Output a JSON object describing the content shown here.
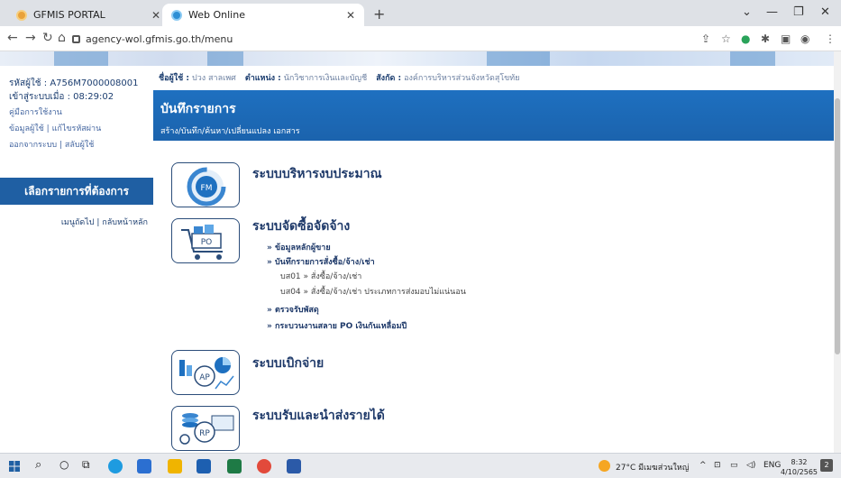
{
  "browser": {
    "tabs": [
      {
        "title": "GFMIS PORTAL",
        "active": false
      },
      {
        "title": "Web Online",
        "active": true
      }
    ],
    "url": "agency-wol.gfmis.go.th/menu"
  },
  "sidebar": {
    "user_id": "รหัสผู้ใช้ : A756M7000008001",
    "login_time": "เข้าสู่ระบบเมื่อ : 08:29:02",
    "manual_link": "คู่มือการใช้งาน",
    "user_info_link": "ข้อมูลผู้ใช้",
    "change_password_link": "แก้ไขรหัสผ่าน",
    "logout_link": "ออกจากระบบ",
    "switch_user_link": "สลับผู้ใช้",
    "menu_title": "เลือกรายการที่ต้องการ",
    "next_menu_link": "เมนูถัดไป",
    "home_link": "กลับหน้าหลัก"
  },
  "userbar": {
    "user_label": "ชื่อผู้ใช้ :",
    "user_value": "ปวง สาลเพศ",
    "position_label": "ตำแหน่ง :",
    "position_value": "นักวิชาการเงินและบัญชี",
    "affiliation_label": "สังกัด :",
    "affiliation_value": "องค์การบริหารส่วนจังหวัดสุโขทัย"
  },
  "header": {
    "title": "บันทึกรายการ",
    "subtitle": "สร้าง/บันทึก/ค้นหา/เปลี่ยนแปลง เอกสาร"
  },
  "systems": {
    "fm": {
      "label": "ระบบบริหารงบประมาณ",
      "icon_text": "FM"
    },
    "po": {
      "label": "ระบบจัดซื้อจัดจ้าง",
      "icon_text": "PO",
      "items": [
        "» ข้อมูลหลักผู้ขาย",
        "» บันทึกรายการสั่งซื้อ/จ้าง/เช่า",
        "บส01 » สั่งซื้อ/จ้าง/เช่า",
        "บส04 » สั่งซื้อ/จ้าง/เช่า ประเภทการส่งมอบไม่แน่นอน",
        "» ตรวจรับพัสดุ",
        "» กระบวนงานสลาย PO เงินกันเหลื่อมปี"
      ]
    },
    "ap": {
      "label": "ระบบเบิกจ่าย",
      "icon_text": "AP"
    },
    "rp": {
      "label": "ระบบรับและนำส่งรายได้",
      "icon_text": "RP"
    }
  },
  "taskbar": {
    "weather": "27°C มีเมฆส่วนใหญ่",
    "lang": "ENG",
    "time": "8:32",
    "date": "4/10/2565",
    "notif_count": "2"
  },
  "colors": {
    "header_blue": "#1e70c0",
    "menu_blue": "#1f5fa3",
    "text_navy": "#1f3a6a"
  }
}
